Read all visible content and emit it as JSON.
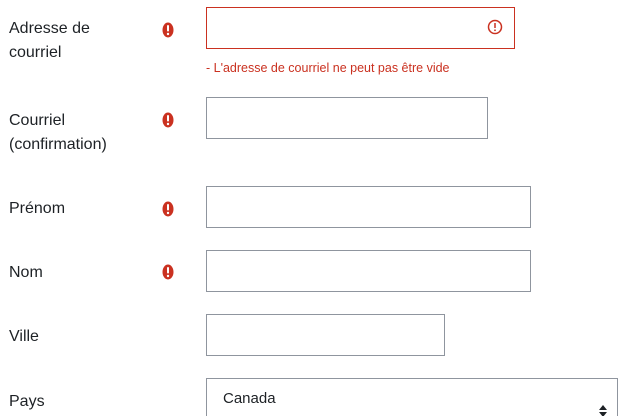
{
  "fields": {
    "email": {
      "label": "Adresse de courriel",
      "value": "",
      "error": "- L'adresse de courriel ne peut pas être vide"
    },
    "email_confirm": {
      "label": "Courriel (confirmation)",
      "value": ""
    },
    "firstname": {
      "label": "Prénom",
      "value": ""
    },
    "lastname": {
      "label": "Nom",
      "value": ""
    },
    "city": {
      "label": "Ville",
      "value": ""
    },
    "country": {
      "label": "Pays",
      "selected": "Canada"
    }
  },
  "icons": {
    "required": "exclamation-circle-icon",
    "invalid": "exclamation-circle-outline-icon",
    "select_arrows": "sort-arrows-icon"
  },
  "colors": {
    "error": "#ca3120",
    "border": "#8f959e",
    "text": "#1d2125"
  }
}
